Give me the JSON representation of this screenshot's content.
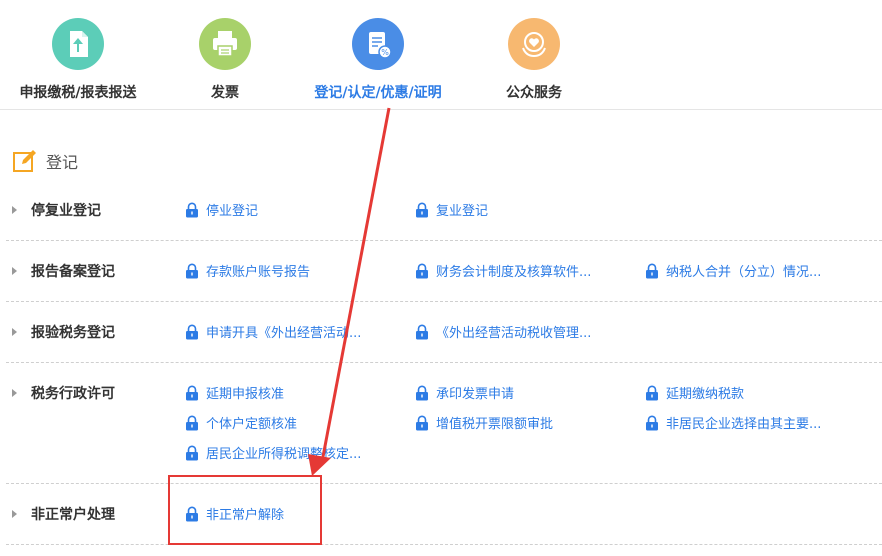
{
  "nav": {
    "items": [
      {
        "label": "申报缴税/报表报送",
        "icon": "upload-document-icon",
        "color": "#5ccdb8"
      },
      {
        "label": "发票",
        "icon": "printer-icon",
        "color": "#a8d16a"
      },
      {
        "label": "登记/认定/优惠/证明",
        "icon": "certificate-icon",
        "color": "#4a8de6"
      },
      {
        "label": "公众服务",
        "icon": "heart-hands-icon",
        "color": "#f7b870"
      }
    ],
    "active_index": 2
  },
  "section": {
    "title": "登记",
    "icon": "edit-icon"
  },
  "rows": [
    {
      "label": "停复业登记",
      "links": [
        "停业登记",
        "复业登记"
      ]
    },
    {
      "label": "报告备案登记",
      "links": [
        "存款账户账号报告",
        "财务会计制度及核算软件...",
        "纳税人合并（分立）情况..."
      ]
    },
    {
      "label": "报验税务登记",
      "links": [
        "申请开具《外出经营活动...",
        "《外出经营活动税收管理..."
      ]
    },
    {
      "label": "税务行政许可",
      "links": [
        "延期申报核准",
        "承印发票申请",
        "延期缴纳税款",
        "个体户定额核准",
        "增值税开票限额审批",
        "非居民企业选择由其主要...",
        "居民企业所得税调整核定..."
      ]
    },
    {
      "label": "非正常户处理",
      "links": [
        "非正常户解除"
      ]
    }
  ],
  "colors": {
    "link": "#2c7be5",
    "highlight": "#e53935"
  }
}
